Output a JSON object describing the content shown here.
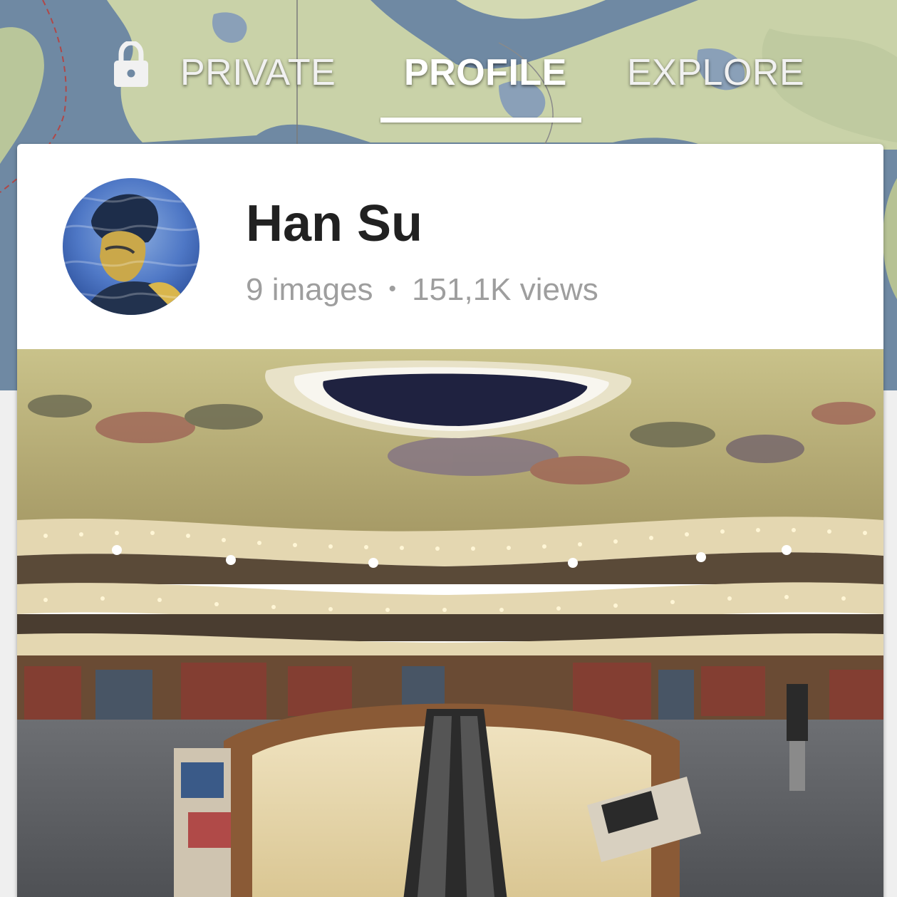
{
  "tabs": {
    "private_label": "PRIVATE",
    "profile_label": "PROFILE",
    "explore_label": "EXPLORE",
    "active_tab": "PROFILE"
  },
  "profile": {
    "name": "Han Su",
    "images_count": "9 images",
    "separator": "•",
    "views_count": "151,1K views"
  },
  "icons": {
    "lock": "lock-icon"
  },
  "colors": {
    "map_water": "#6f89a3",
    "map_land": "#c9d2a8",
    "tab_text": "#f1f1f1",
    "name_text": "#212121",
    "stats_text": "#9e9e9e"
  }
}
